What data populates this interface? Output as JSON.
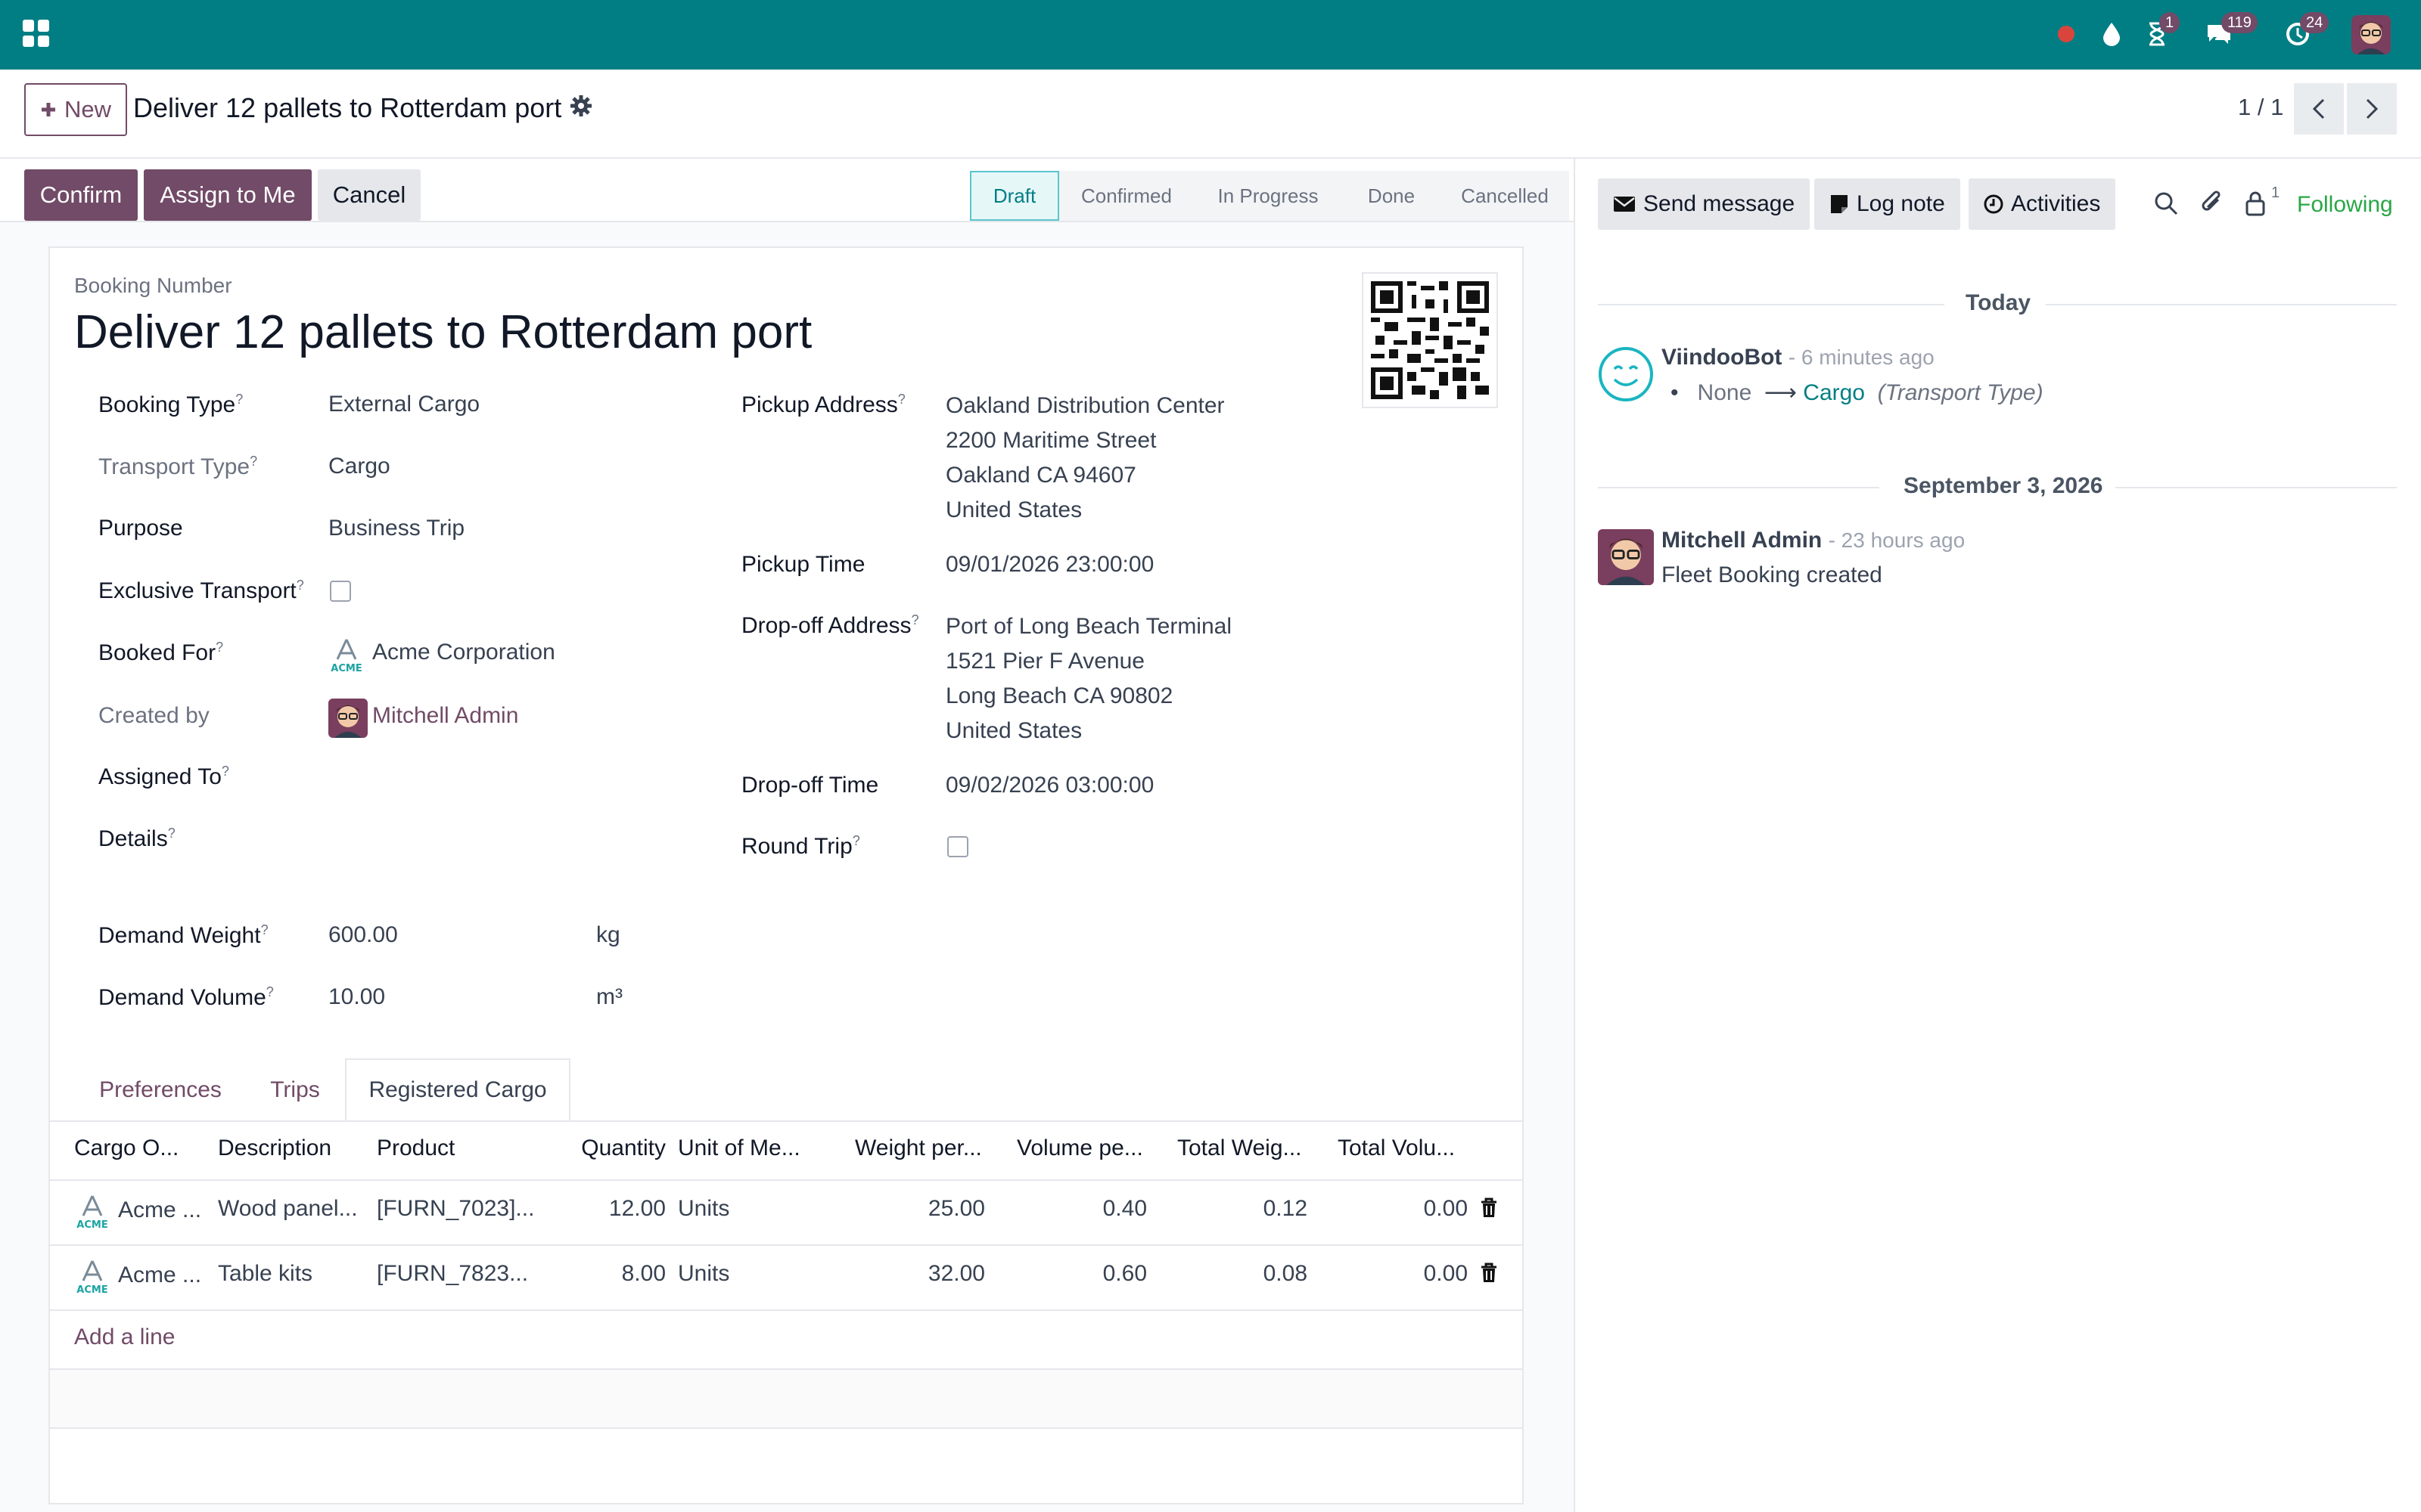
{
  "navbar": {
    "badges": {
      "activities": "1",
      "messages": "119",
      "updates": "24"
    }
  },
  "control": {
    "new_label": "New",
    "breadcrumb_title": "Deliver 12 pallets to Rotterdam port",
    "pager": "1 / 1"
  },
  "actions": {
    "confirm": "Confirm",
    "assign": "Assign to Me",
    "cancel": "Cancel"
  },
  "stages": [
    "Draft",
    "Confirmed",
    "In Progress",
    "Done",
    "Cancelled"
  ],
  "form": {
    "booking_number_label": "Booking Number",
    "title": "Deliver 12 pallets to Rotterdam port",
    "left": {
      "booking_type_label": "Booking Type",
      "booking_type": "External Cargo",
      "transport_type_label": "Transport Type",
      "transport_type": "Cargo",
      "purpose_label": "Purpose",
      "purpose": "Business Trip",
      "exclusive_label": "Exclusive Transport",
      "booked_for_label": "Booked For",
      "booked_for": "Acme Corporation",
      "created_by_label": "Created by",
      "created_by": "Mitchell Admin",
      "assigned_to_label": "Assigned To",
      "details_label": "Details",
      "weight_label": "Demand Weight",
      "weight": "600.00",
      "weight_unit": "kg",
      "volume_label": "Demand Volume",
      "volume": "10.00",
      "volume_unit": "m³"
    },
    "right": {
      "pickup_address_label": "Pickup Address",
      "pickup_address": [
        "Oakland Distribution Center",
        "2200 Maritime Street",
        "Oakland CA 94607",
        "United States"
      ],
      "pickup_time_label": "Pickup Time",
      "pickup_time": "09/01/2026 23:00:00",
      "dropoff_address_label": "Drop-off Address",
      "dropoff_address": [
        "Port of Long Beach Terminal",
        "1521 Pier F Avenue",
        "Long Beach CA 90802",
        "United States"
      ],
      "dropoff_time_label": "Drop-off Time",
      "dropoff_time": "09/02/2026 03:00:00",
      "round_trip_label": "Round Trip"
    }
  },
  "tabs": [
    "Preferences",
    "Trips",
    "Registered Cargo"
  ],
  "table": {
    "headers": [
      "Cargo O...",
      "Description",
      "Product",
      "Quantity",
      "Unit of Me...",
      "Weight per...",
      "Volume pe...",
      "Total Weig...",
      "Total Volu..."
    ],
    "rows": [
      {
        "owner": "Acme ...",
        "description": "Wood panel...",
        "product": "[FURN_7023]...",
        "quantity": "12.00",
        "uom": "Units",
        "weight_per": "25.00",
        "volume_per": "0.40",
        "total_weight": "0.12",
        "total_volume": "0.00"
      },
      {
        "owner": "Acme ...",
        "description": "Table kits",
        "product": "[FURN_7823...",
        "quantity": "8.00",
        "uom": "Units",
        "weight_per": "32.00",
        "volume_per": "0.60",
        "total_weight": "0.08",
        "total_volume": "0.00"
      }
    ],
    "add_line": "Add a line"
  },
  "chatter": {
    "send_message": "Send message",
    "log_note": "Log note",
    "activities": "Activities",
    "followers_count": "1",
    "following": "Following",
    "today": "Today",
    "msg1": {
      "author": "ViindooBot",
      "time": "- 6 minutes ago",
      "old": "None",
      "new": "Cargo",
      "field": "(Transport Type)"
    },
    "date2": "September 3, 2026",
    "msg2": {
      "author": "Mitchell Admin",
      "time": "- 23 hours ago",
      "body": "Fleet Booking created"
    }
  }
}
